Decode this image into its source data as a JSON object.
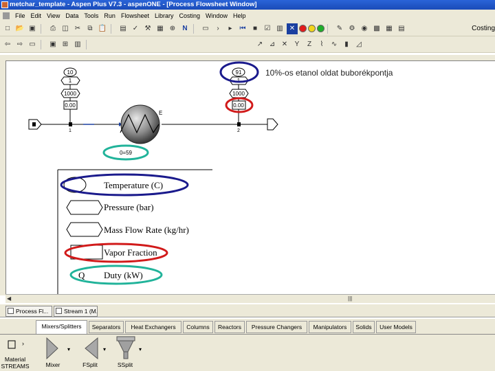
{
  "window": {
    "title": "metchar_template - Aspen Plus V7.3 - aspenONE - [Process Flowsheet Window]"
  },
  "menu": [
    "File",
    "Edit",
    "View",
    "Data",
    "Tools",
    "Run",
    "Flowsheet",
    "Library",
    "Costing",
    "Window",
    "Help"
  ],
  "toolbar": {
    "costing_label": "Costing"
  },
  "toolbar2": {
    "mode_label": "N"
  },
  "flowsheet": {
    "stream_left": {
      "temperature": "10",
      "pressure": "1",
      "mass_flow": "1000",
      "vapor_fraction": "0.00",
      "id": "1"
    },
    "stream_right": {
      "temperature": "91",
      "pressure": "1",
      "mass_flow": "1000",
      "vapor_fraction": "0.00",
      "id": "2"
    },
    "block": {
      "name": "E",
      "duty": "0=59"
    },
    "annotation": "10%-os etanol oldat buborékpontja"
  },
  "legend": {
    "temperature": "Temperature (C)",
    "pressure": "Pressure (bar)",
    "mass_flow": "Mass Flow Rate (kg/hr)",
    "vapor_fraction": "Vapor Fraction",
    "duty_symbol": "Q",
    "duty": "Duty (kW)"
  },
  "highlight_colors": {
    "blue": "#1a1a8c",
    "red": "#d11a1a",
    "teal": "#21b39a"
  },
  "window_tabs": [
    "Process Fl...",
    "Stream 1 (M..."
  ],
  "palette_tabs": [
    "Mixers/Splitters",
    "Separators",
    "Heat Exchangers",
    "Columns",
    "Reactors",
    "Pressure Changers",
    "Manipulators",
    "Solids",
    "User Models"
  ],
  "palette_items": [
    "Material STREAMS",
    "Mixer",
    "FSplit",
    "SSplit"
  ]
}
